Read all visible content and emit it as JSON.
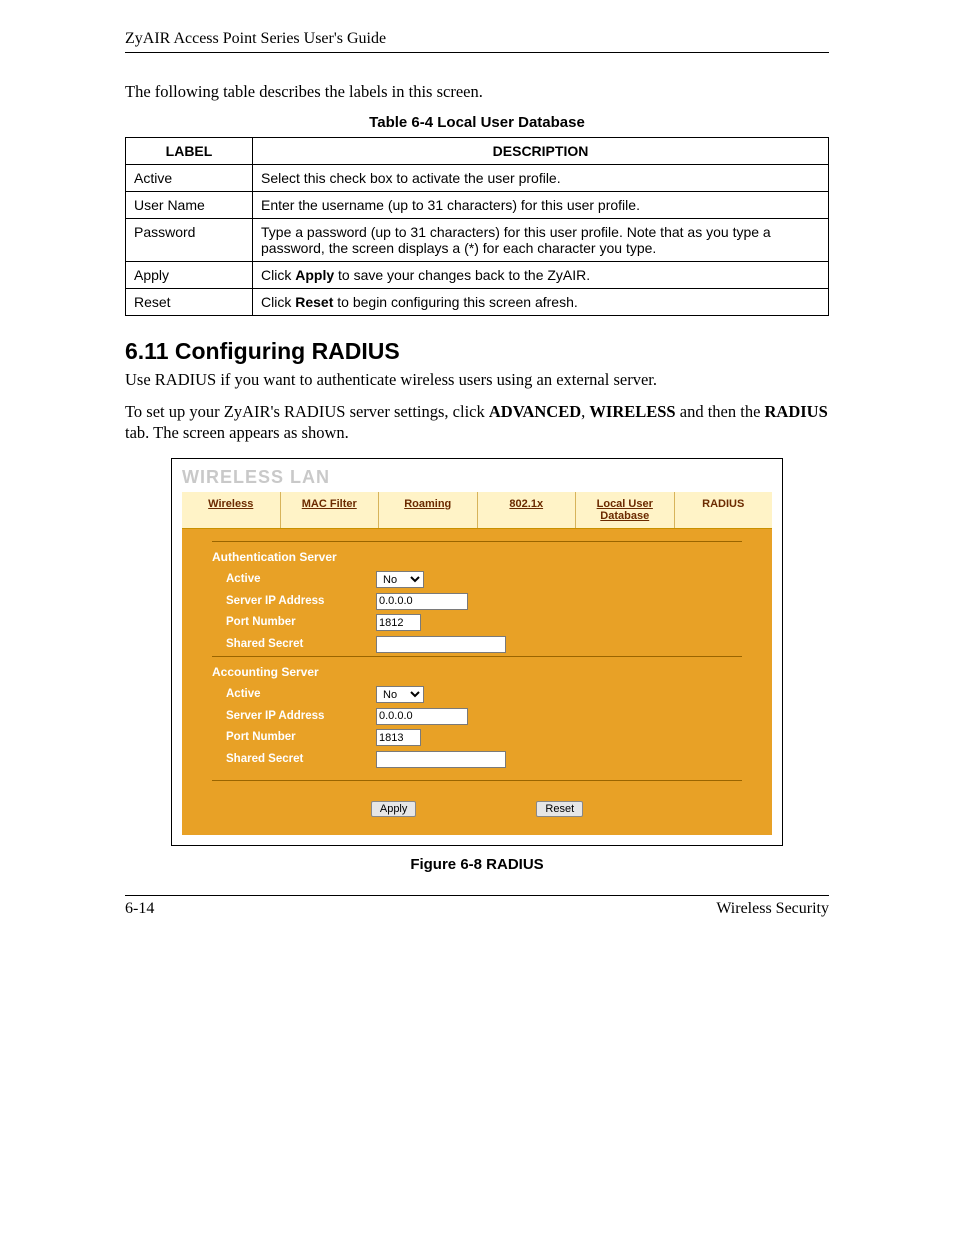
{
  "header": {
    "guide_title": "ZyAIR Access Point Series User's Guide"
  },
  "intro_para": "The following table describes the labels in this screen.",
  "table": {
    "caption": "Table 6-4 Local User Database",
    "columns": [
      "LABEL",
      "DESCRIPTION"
    ],
    "rows": [
      {
        "label": "Active",
        "desc_pre": "Select this check box to activate the user profile.",
        "bold": "",
        "desc_post": ""
      },
      {
        "label": "User Name",
        "desc_pre": "Enter the username (up to 31 characters) for this user profile.",
        "bold": "",
        "desc_post": ""
      },
      {
        "label": "Password",
        "desc_pre": "Type a password (up to 31 characters) for this user profile. Note that as you type a password, the screen displays a (*) for each character you type.",
        "bold": "",
        "desc_post": ""
      },
      {
        "label": "Apply",
        "desc_pre": "Click ",
        "bold": "Apply",
        "desc_post": " to save your changes back to the ZyAIR."
      },
      {
        "label": "Reset",
        "desc_pre": "Click ",
        "bold": "Reset",
        "desc_post": " to begin configuring this screen afresh."
      }
    ]
  },
  "section": {
    "heading": "6.11  Configuring RADIUS",
    "para1": "Use RADIUS if you want to authenticate wireless users using an external server.",
    "para2_pre": "To set up your ZyAIR's RADIUS server settings, click ",
    "para2_b1": "ADVANCED",
    "para2_mid1": ", ",
    "para2_b2": "WIRELESS",
    "para2_mid2": " and then the ",
    "para2_b3": "RADIUS",
    "para2_post": " tab. The screen appears as shown."
  },
  "wlan": {
    "title": "WIRELESS LAN",
    "tabs": [
      "Wireless",
      "MAC Filter",
      "Roaming",
      "802.1x",
      "Local User Database",
      "RADIUS"
    ],
    "selected_tab_index": 5,
    "auth_section": "Authentication Server",
    "acct_section": "Accounting Server",
    "labels": {
      "active": "Active",
      "server_ip": "Server IP Address",
      "port": "Port Number",
      "secret": "Shared Secret"
    },
    "auth": {
      "active": "No",
      "ip": "0.0.0.0",
      "port": "1812",
      "secret": ""
    },
    "acct": {
      "active": "No",
      "ip": "0.0.0.0",
      "port": "1813",
      "secret": ""
    },
    "buttons": {
      "apply": "Apply",
      "reset": "Reset"
    }
  },
  "figure_caption": "Figure 6-8 RADIUS",
  "footer": {
    "page": "6-14",
    "chapter": "Wireless Security"
  }
}
